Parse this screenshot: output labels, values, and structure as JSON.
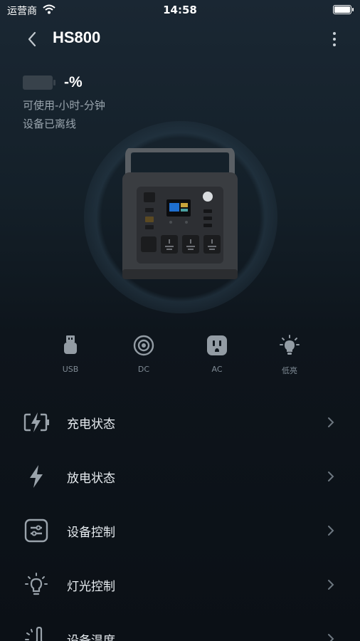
{
  "status_bar": {
    "carrier": "运营商",
    "time": "14:58"
  },
  "header": {
    "title": "HS800"
  },
  "battery": {
    "percent": "-%",
    "usable": "可使用-小时-分钟",
    "connection": "设备已离线"
  },
  "outputs": [
    {
      "label": "USB",
      "icon": "usb-icon"
    },
    {
      "label": "DC",
      "icon": "dc-port-icon"
    },
    {
      "label": "AC",
      "icon": "ac-outlet-icon"
    },
    {
      "label": "低亮",
      "icon": "light-bulb-icon"
    }
  ],
  "menu": [
    {
      "label": "充电状态",
      "icon": "charging-icon"
    },
    {
      "label": "放电状态",
      "icon": "lightning-icon"
    },
    {
      "label": "设备控制",
      "icon": "sliders-icon"
    },
    {
      "label": "灯光控制",
      "icon": "lamp-icon"
    },
    {
      "label": "设备温度",
      "icon": "thermometer-icon"
    }
  ],
  "colors": {
    "background": "#0b1117",
    "text": "#e9eef2",
    "muted": "#9aa5ae",
    "icon": "#9aa3ab"
  }
}
